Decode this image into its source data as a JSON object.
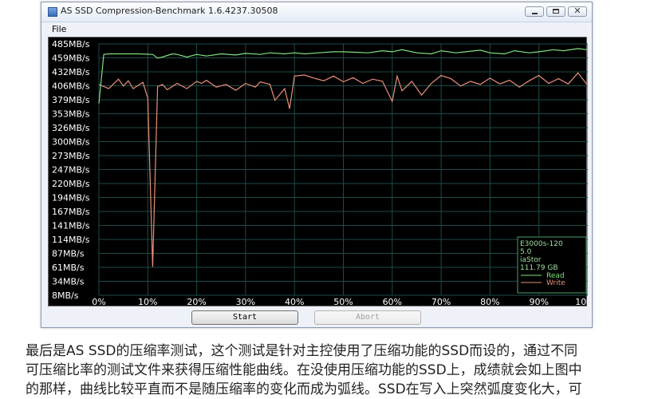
{
  "window": {
    "title": "AS SSD Compression-Benchmark 1.6.4237.30508",
    "menu": [
      "File"
    ],
    "buttons": {
      "start": "Start",
      "abort": "Abort"
    }
  },
  "legend": {
    "lines": [
      "E3000s-120",
      "5.0",
      "iaStor",
      "111.79 GB"
    ],
    "read_label": "Read",
    "write_label": "Write"
  },
  "colors": {
    "read": "#7fe07f",
    "write": "#e8907a",
    "grid": "#1b4a4a",
    "axis_text": "#ffffff",
    "legend_box": "#4aa06a"
  },
  "chart_data": {
    "type": "line",
    "title": "",
    "xlabel": "",
    "ylabel": "",
    "x_tick_labels": [
      "0%",
      "10%",
      "20%",
      "30%",
      "40%",
      "50%",
      "60%",
      "70%",
      "80%",
      "90%",
      "100%"
    ],
    "x_ticks": [
      0,
      10,
      20,
      30,
      40,
      50,
      60,
      70,
      80,
      90,
      100
    ],
    "y_tick_labels": [
      "485MB/s",
      "459MB/s",
      "432MB/s",
      "406MB/s",
      "379MB/s",
      "353MB/s",
      "326MB/s",
      "300MB/s",
      "273MB/s",
      "247MB/s",
      "220MB/s",
      "194MB/s",
      "167MB/s",
      "141MB/s",
      "114MB/s",
      "87MB/s",
      "61MB/s",
      "34MB/s",
      "8MB/s"
    ],
    "ylim": [
      8,
      485
    ],
    "xlim": [
      0,
      100
    ],
    "series": [
      {
        "name": "Read",
        "x": [
          0,
          1,
          2,
          5,
          8,
          11,
          12,
          13,
          15,
          16,
          18,
          20,
          22,
          25,
          28,
          30,
          33,
          35,
          38,
          40,
          42,
          45,
          48,
          50,
          53,
          55,
          58,
          60,
          62,
          65,
          68,
          70,
          73,
          75,
          78,
          80,
          83,
          85,
          88,
          90,
          93,
          95,
          98,
          100
        ],
        "y": [
          372,
          465,
          466,
          466,
          466,
          465,
          458,
          460,
          466,
          465,
          460,
          465,
          462,
          466,
          464,
          467,
          465,
          468,
          466,
          468,
          466,
          468,
          470,
          470,
          469,
          468,
          472,
          470,
          474,
          468,
          466,
          472,
          468,
          470,
          473,
          468,
          466,
          472,
          468,
          470,
          474,
          472,
          476,
          474
        ]
      },
      {
        "name": "Write",
        "x": [
          0,
          2,
          4,
          5,
          6,
          7,
          9,
          10,
          11,
          12,
          13,
          14,
          16,
          18,
          20,
          21,
          22,
          24,
          26,
          28,
          30,
          32,
          33,
          35,
          36,
          38,
          39,
          40,
          42,
          44,
          46,
          48,
          50,
          52,
          54,
          56,
          58,
          60,
          61,
          62,
          64,
          66,
          68,
          70,
          72,
          74,
          76,
          78,
          80,
          82,
          84,
          86,
          88,
          90,
          92,
          94,
          96,
          98,
          100
        ],
        "y": [
          408,
          400,
          418,
          405,
          415,
          400,
          412,
          382,
          62,
          404,
          408,
          398,
          410,
          400,
          414,
          410,
          416,
          403,
          408,
          397,
          410,
          403,
          413,
          408,
          378,
          400,
          362,
          424,
          426,
          420,
          415,
          424,
          413,
          421,
          410,
          418,
          414,
          376,
          424,
          396,
          414,
          388,
          410,
          425,
          419,
          405,
          414,
          408,
          420,
          409,
          416,
          403,
          415,
          425,
          410,
          419,
          409,
          430,
          406
        ]
      }
    ],
    "legend_position": "bottom-right",
    "grid": true
  },
  "caption": {
    "lines": [
      "最后是AS SSD的压缩率测试，这个测试是针对主控使用了压缩功能的SSD而设的，通过不同",
      "可压缩比率的测试文件来获得压缩性能曲线。在没使用压缩功能的SSD上，成绩就会如上图中",
      "的那样，曲线比较平直而不是随压缩率的变化而成为弧线。SSD在写入上突然弧度变化大，可"
    ]
  }
}
